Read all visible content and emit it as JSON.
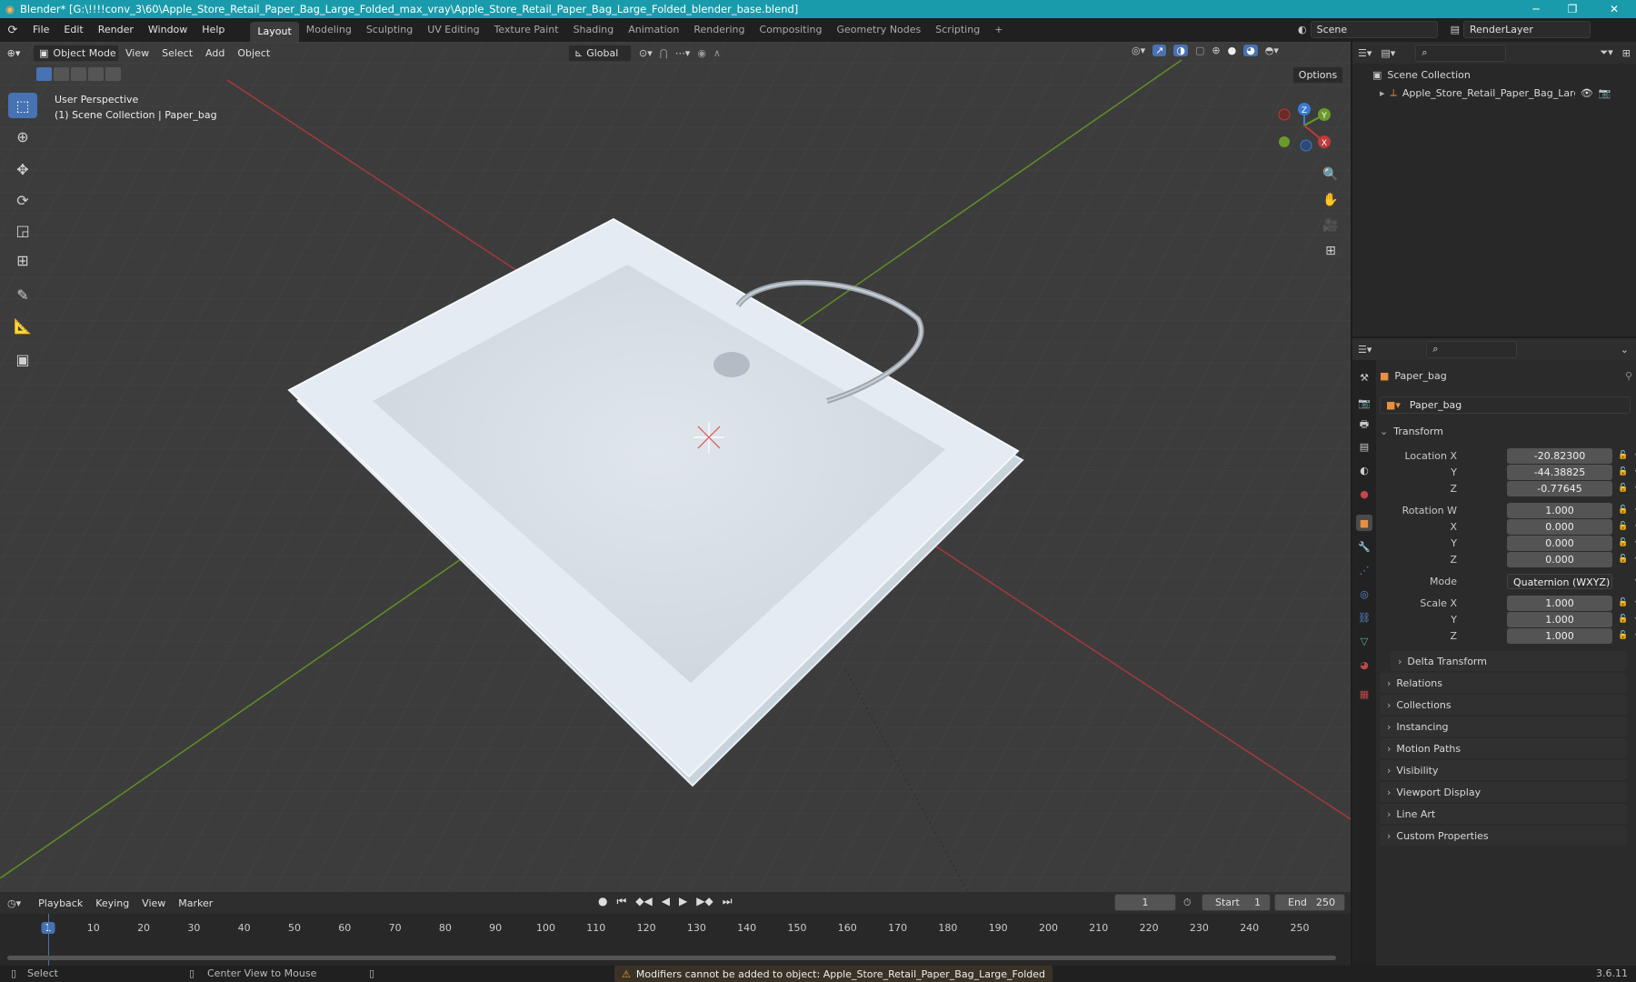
{
  "window": {
    "title": "Blender* [G:\\!!!!conv_3\\60\\Apple_Store_Retail_Paper_Bag_Large_Folded_max_vray\\Apple_Store_Retail_Paper_Bag_Large_Folded_blender_base.blend]",
    "minimize": "─",
    "maximize": "❐",
    "close": "✕"
  },
  "menu": {
    "items": [
      "File",
      "Edit",
      "Render",
      "Window",
      "Help"
    ],
    "workspaces": [
      "Layout",
      "Modeling",
      "Sculpting",
      "UV Editing",
      "Texture Paint",
      "Shading",
      "Animation",
      "Rendering",
      "Compositing",
      "Geometry Nodes",
      "Scripting"
    ],
    "active_workspace": "Layout",
    "add_workspace": "+",
    "scene": "Scene",
    "render_layer": "RenderLayer"
  },
  "viewport": {
    "mode": "Object Mode",
    "menus": [
      "View",
      "Select",
      "Add",
      "Object"
    ],
    "orientation": "Global",
    "options": "Options",
    "overlay_title": "User Perspective",
    "overlay_subtitle": "(1) Scene Collection | Paper_bag",
    "gizmo": {
      "z": "Z",
      "y": "Y",
      "x": "X"
    }
  },
  "outliner": {
    "root": "Scene Collection",
    "item": "Apple_Store_Retail_Paper_Bag_Large_Fo"
  },
  "properties": {
    "object_name": "Paper_bag",
    "data_name": "Paper_bag",
    "transform_label": "Transform",
    "location": {
      "label_x": "Location X",
      "label_y": "Y",
      "label_z": "Z",
      "x": "-20.82300",
      "y": "-44.38825",
      "z": "-0.77645"
    },
    "rotation": {
      "label_w": "Rotation W",
      "label_x": "X",
      "label_y": "Y",
      "label_z": "Z",
      "w": "1.000",
      "x": "0.000",
      "y": "0.000",
      "z": "0.000"
    },
    "mode_label": "Mode",
    "mode_value": "Quaternion (WXYZ)",
    "scale": {
      "label_x": "Scale X",
      "label_y": "Y",
      "label_z": "Z",
      "x": "1.000",
      "y": "1.000",
      "z": "1.000"
    },
    "delta_transform": "Delta Transform",
    "panels": [
      "Relations",
      "Collections",
      "Instancing",
      "Motion Paths",
      "Visibility",
      "Viewport Display",
      "Line Art",
      "Custom Properties"
    ]
  },
  "timeline": {
    "menus": [
      "Playback",
      "Keying",
      "View",
      "Marker"
    ],
    "current_frame": "1",
    "start_label": "Start",
    "start": "1",
    "end_label": "End",
    "end": "250",
    "ticks": [
      "1",
      "10",
      "20",
      "30",
      "40",
      "50",
      "60",
      "70",
      "80",
      "90",
      "100",
      "110",
      "120",
      "130",
      "140",
      "150",
      "160",
      "170",
      "180",
      "190",
      "200",
      "210",
      "220",
      "230",
      "240",
      "250"
    ]
  },
  "status": {
    "select": "Select",
    "center_view": "Center View to Mouse",
    "warning": "Modifiers cannot be added to object: Apple_Store_Retail_Paper_Bag_Large_Folded",
    "version": "3.6.11"
  },
  "colors": {
    "titlebar": "#1a9bab",
    "accent": "#4772b3",
    "axis_x": "#c0393b",
    "axis_y": "#6a9b2a",
    "axis_z": "#3a7ad0",
    "warning": "#e8a030"
  }
}
